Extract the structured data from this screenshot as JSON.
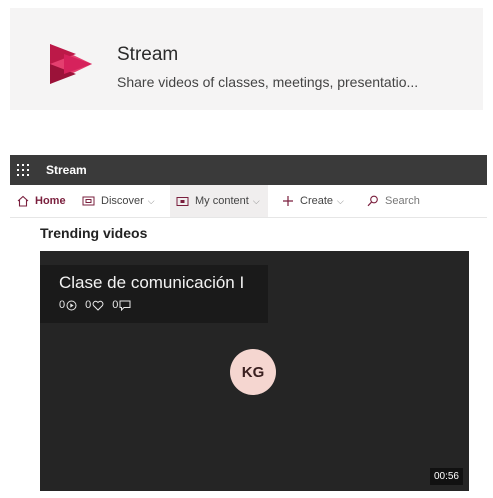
{
  "app_card": {
    "name": "Stream",
    "description": "Share videos of classes, meetings, presentatio..."
  },
  "titlebar": {
    "title": "Stream"
  },
  "nav": {
    "home": "Home",
    "discover": "Discover",
    "my_content": "My content",
    "create": "Create",
    "search": "Search"
  },
  "section": {
    "title": "Trending videos"
  },
  "video": {
    "title": "Clase de comunicación I",
    "views": "0",
    "likes": "0",
    "comments": "0",
    "owner_initials": "KG",
    "duration": "00:56"
  },
  "colors": {
    "brand": "#bc1948",
    "titlebar": "#3a3a3a",
    "avatar_bg": "#f5d6d0"
  }
}
